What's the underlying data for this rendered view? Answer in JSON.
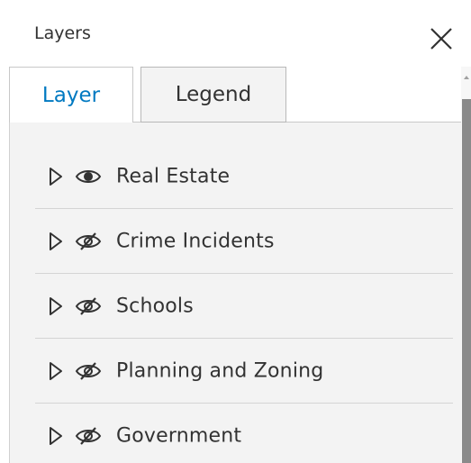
{
  "panel": {
    "title": "Layers",
    "close_icon": "close-icon"
  },
  "tabs": [
    {
      "label": "Layer",
      "active": true
    },
    {
      "label": "Legend",
      "active": false
    }
  ],
  "layers": [
    {
      "name": "Real Estate",
      "visible": true,
      "eye_icon": "eye-icon"
    },
    {
      "name": "Crime Incidents",
      "visible": false,
      "eye_icon": "eye-slash-icon"
    },
    {
      "name": "Schools",
      "visible": false,
      "eye_icon": "eye-slash-icon"
    },
    {
      "name": "Planning and Zoning",
      "visible": false,
      "eye_icon": "eye-slash-icon"
    },
    {
      "name": "Government",
      "visible": false,
      "eye_icon": "eye-slash-icon"
    }
  ],
  "colors": {
    "accent": "#0079c1",
    "text": "#323232",
    "content_bg": "#f3f3f3",
    "divider": "#d4d4d4",
    "scrollbar_thumb": "#8a8a8a"
  }
}
